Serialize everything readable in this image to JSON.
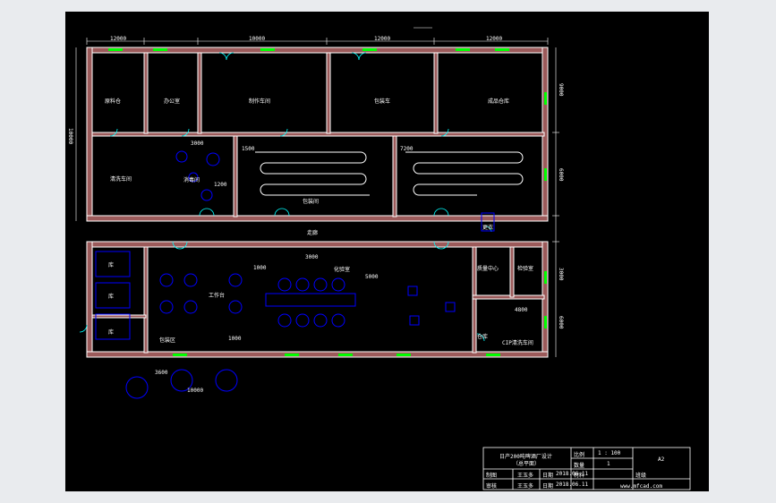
{
  "drawing": {
    "dimension_labels_top": [
      "12000",
      "",
      "10000",
      "",
      "12000",
      "12000"
    ],
    "dimension_labels_left": [
      "10000"
    ],
    "dimension_labels_right": [
      "9000",
      "6000",
      "3000",
      "6000"
    ],
    "room_labels": [
      "原料仓",
      "办公室",
      "制作车间",
      "包装车",
      "成品仓库",
      "清洗车间",
      "消毒间",
      "包装间",
      "工作台",
      "包装区",
      "走廊",
      "库",
      "库",
      "库",
      "质量中心",
      "检验室",
      "化验室",
      "更衣",
      "仓库",
      "CIP清洗车间"
    ],
    "misc_labels": [
      "3000",
      "1200",
      "1500",
      "7200",
      "3000",
      "5000",
      "1000",
      "3600",
      "10000",
      "1000",
      "4800"
    ]
  },
  "title_block": {
    "project": "日产200吨啤酒厂设计",
    "subtitle": "（总平面）",
    "scale_label": "比例",
    "scale_value": "1 : 100",
    "sheet_label": "数量",
    "sheet_value": "1",
    "material_label": "材料",
    "drawing_no": "A2",
    "drawn_label": "制图",
    "drawn_by": "王玉多",
    "drawn_date_label": "日期",
    "drawn_date": "2018.06.11",
    "checked_label": "审核",
    "checked_by": "王玉多",
    "checked_date_label": "日期",
    "checked_date": "2018.06.11",
    "school_label": "班级",
    "footer": "www.mfcad.com"
  },
  "colors": {
    "background": "#000000",
    "wall": "#ffffff",
    "wall_fill": "#a06060",
    "window": "#00ff00",
    "door": "#00ffff",
    "equipment": "#0000ff",
    "text": "#ffffff"
  }
}
